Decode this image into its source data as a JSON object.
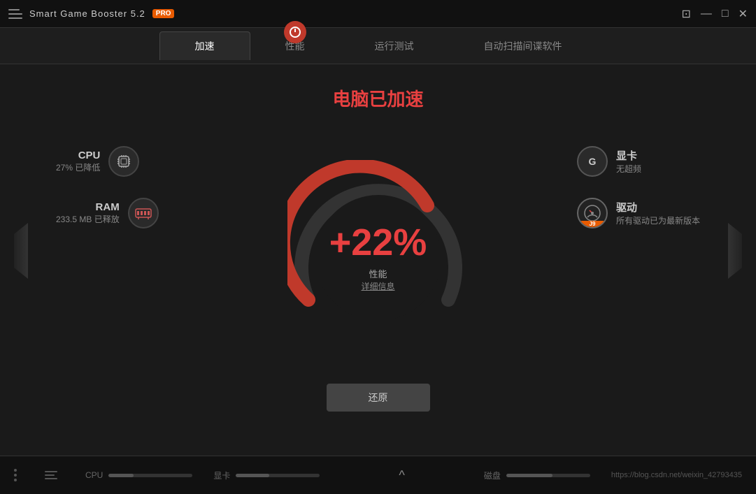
{
  "app": {
    "title": "Smart Game Booster 5.2",
    "badge": "PRO"
  },
  "titlebar": {
    "screenshot_icon": "⊡",
    "minimize": "—",
    "maximize": "□",
    "close": "✕"
  },
  "tabs": [
    {
      "label": "加速",
      "active": true
    },
    {
      "label": "性能",
      "active": false
    },
    {
      "label": "运行测试",
      "active": false
    },
    {
      "label": "自动扫描间谍软件",
      "active": false
    }
  ],
  "status_title": "电脑已加速",
  "gauge": {
    "value": "+22%",
    "sub_label": "性能",
    "detail_link": "详细信息"
  },
  "cpu_stat": {
    "label": "CPU",
    "value": "27% 已降低",
    "icon": "💾"
  },
  "ram_stat": {
    "label": "RAM",
    "value": "233.5 MB 已释放",
    "icon": "📀"
  },
  "gpu_stat": {
    "label": "显卡",
    "value": "无超频",
    "icon": "G"
  },
  "driver_stat": {
    "label": "驱动",
    "value": "所有驱动已为最新版本",
    "icon": "J9"
  },
  "restore_btn": "还原",
  "bottom": {
    "cpu_label": "CPU",
    "gpu_label": "显卡",
    "disk_label": "磁盘",
    "url": "https://blog.csdn.net/weixin_42793435",
    "cpu_fill": 30,
    "gpu_fill": 40,
    "disk_fill": 55
  }
}
